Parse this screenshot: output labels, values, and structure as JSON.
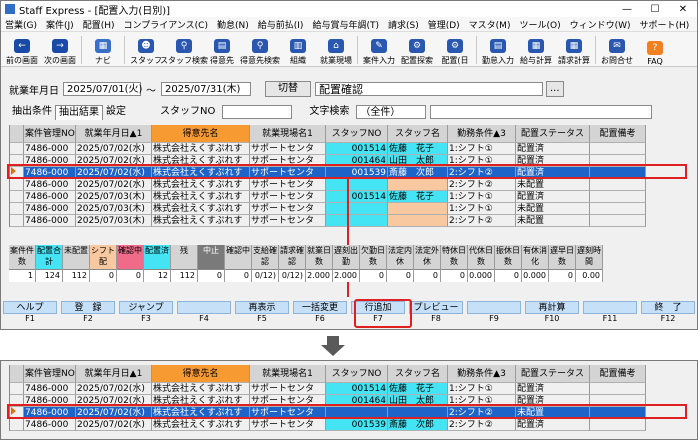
{
  "window": {
    "title": "Staff Express - [配置入力(日別)]",
    "controls": [
      "—",
      "☐",
      "✕"
    ]
  },
  "menu": [
    "営業(G)",
    "案件(J)",
    "配置(H)",
    "コンプライアンス(C)",
    "勤怠(N)",
    "給与前払(I)",
    "給与賞与年調(T)",
    "請求(S)",
    "管理(D)",
    "マスタ(M)",
    "ツール(O)",
    "ウィンドウ(W)",
    "サポート(H)"
  ],
  "toolbar": [
    {
      "label": "前の画面",
      "icon": "←",
      "color": "#1a4aa8"
    },
    {
      "label": "次の画面",
      "icon": "→",
      "color": "#1a4aa8"
    },
    {
      "label": "ナビ",
      "icon": "▦",
      "color": "#3a6fc8"
    },
    {
      "label": "スタッフ",
      "icon": "☻",
      "color": "#2a58b0"
    },
    {
      "label": "スタッフ検索",
      "icon": "⚲",
      "color": "#2a58b0"
    },
    {
      "label": "得意先",
      "icon": "▤",
      "color": "#2a58b0"
    },
    {
      "label": "得意先検索",
      "icon": "⚲",
      "color": "#2a58b0"
    },
    {
      "label": "組織",
      "icon": "▥",
      "color": "#2a58b0"
    },
    {
      "label": "就業現場",
      "icon": "⌂",
      "color": "#2a58b0"
    },
    {
      "label": "案件入力",
      "icon": "✎",
      "color": "#2a58b0"
    },
    {
      "label": "配置探索",
      "icon": "⚙",
      "color": "#2a58b0"
    },
    {
      "label": "配置(日",
      "icon": "⚙",
      "color": "#2a58b0"
    },
    {
      "label": "勤怠入力",
      "icon": "▤",
      "color": "#2a58b0"
    },
    {
      "label": "給与計算",
      "icon": "▦",
      "color": "#2a58b0"
    },
    {
      "label": "請求計算",
      "icon": "▦",
      "color": "#2a58b0"
    },
    {
      "label": "お問合せ",
      "icon": "✉",
      "color": "#2a58b0"
    },
    {
      "label": "FAQ",
      "icon": "?",
      "color": "#f08020"
    }
  ],
  "filters": {
    "date_label": "就業年月日",
    "date_from": "2025/07/01(火)",
    "tilde": "〜",
    "date_to": "2025/07/31(木)",
    "switch_button": "切替",
    "mode": "配置確認",
    "more": "...",
    "staff_no_label": "スタッフNO",
    "text_search_label": "文字検索",
    "text_search_value": "（全件）"
  },
  "tabs": [
    "抽出条件",
    "抽出結果",
    "設定"
  ],
  "columns": [
    "案件管理NO",
    "就業年月日▲1",
    "得意先名",
    "就業現場名1",
    "スタッフNO",
    "スタッフ名",
    "勤務条件▲3",
    "配置ステータス",
    "配置備考"
  ],
  "rows": [
    {
      "no": "7486-000",
      "date": "2025/07/02(水)",
      "client": "株式会社えくすぷれす",
      "site": "サポートセンタ",
      "staff_no": "001514",
      "staff": "佐藤　花子",
      "cond": "1:シフト①",
      "status": "配置済",
      "note": "",
      "selected": false
    },
    {
      "no": "7486-000",
      "date": "2025/07/02(水)",
      "client": "株式会社えくすぷれす",
      "site": "サポートセンタ",
      "staff_no": "001464",
      "staff": "山田　太郎",
      "cond": "1:シフト①",
      "status": "配置済",
      "note": "",
      "selected": false
    },
    {
      "no": "7486-000",
      "date": "2025/07/02(水)",
      "client": "株式会社えくすぷれす",
      "site": "サポートセンタ",
      "staff_no": "001539",
      "staff": "斎藤　次郎",
      "cond": "2:シフト②",
      "status": "配置済",
      "note": "",
      "selected": true
    },
    {
      "no": "7486-000",
      "date": "2025/07/02(水)",
      "client": "株式会社えくすぷれす",
      "site": "サポートセンタ",
      "staff_no": "",
      "staff": "",
      "cond": "2:シフト②",
      "status": "未配置",
      "note": "",
      "selected": false
    },
    {
      "no": "7486-000",
      "date": "2025/07/03(木)",
      "client": "株式会社えくすぷれす",
      "site": "サポートセンタ",
      "staff_no": "001514",
      "staff": "佐藤　花子",
      "cond": "1:シフト①",
      "status": "配置済",
      "note": "",
      "selected": false
    },
    {
      "no": "7486-000",
      "date": "2025/07/03(木)",
      "client": "株式会社えくすぷれす",
      "site": "サポートセンタ",
      "staff_no": "",
      "staff": "",
      "cond": "1:シフト①",
      "status": "未配置",
      "note": "",
      "selected": false
    },
    {
      "no": "7486-000",
      "date": "2025/07/03(木)",
      "client": "株式会社えくすぷれす",
      "site": "サポートセンタ",
      "staff_no": "",
      "staff": "",
      "cond": "2:シフト②",
      "status": "未配置",
      "note": "",
      "selected": false
    }
  ],
  "summary": [
    {
      "h": "案件件数",
      "v": "1"
    },
    {
      "h": "配置合計",
      "v": "124"
    },
    {
      "h": "未配置",
      "v": "112"
    },
    {
      "h": "シフト配",
      "v": "0"
    },
    {
      "h": "確認中",
      "v": "0"
    },
    {
      "h": "配置済",
      "v": "12"
    },
    {
      "h": "残",
      "v": "112"
    },
    {
      "h": "中止",
      "v": "0"
    },
    {
      "h": "確認中",
      "v": "0"
    },
    {
      "h": "支給確認",
      "v": "0/12)"
    },
    {
      "h": "請求確認",
      "v": "0/12)"
    },
    {
      "h": "就業日数",
      "v": "2.000"
    },
    {
      "h": "遅刻出勤",
      "v": "2.000"
    },
    {
      "h": "欠勤日数",
      "v": "0"
    },
    {
      "h": "法定内休",
      "v": "0"
    },
    {
      "h": "法定外休",
      "v": "0"
    },
    {
      "h": "特休日数",
      "v": "0"
    },
    {
      "h": "代休日数",
      "v": "0.000"
    },
    {
      "h": "振休日数",
      "v": "0"
    },
    {
      "h": "有休消化",
      "v": "0.000"
    },
    {
      "h": "遅早日数",
      "v": "0"
    },
    {
      "h": "遅刻時間",
      "v": "0.00"
    }
  ],
  "fkeys": [
    {
      "label": "ヘルプ",
      "key": "F1"
    },
    {
      "label": "登　録",
      "key": "F2"
    },
    {
      "label": "ジャンプ",
      "key": "F3"
    },
    {
      "label": "",
      "key": "F4"
    },
    {
      "label": "再表示",
      "key": "F5"
    },
    {
      "label": "一括変更",
      "key": "F6"
    },
    {
      "label": "行追加",
      "key": "F7"
    },
    {
      "label": "プレビュー",
      "key": "F8"
    },
    {
      "label": "",
      "key": "F9"
    },
    {
      "label": "再計算",
      "key": "F10"
    },
    {
      "label": "",
      "key": "F11"
    },
    {
      "label": "終　了",
      "key": "F12"
    }
  ],
  "after_rows": [
    {
      "no": "7486-000",
      "date": "2025/07/02(水)",
      "client": "株式会社えくすぷれす",
      "site": "サポートセンタ",
      "staff_no": "001514",
      "staff": "佐藤　花子",
      "cond": "1:シフト①",
      "status": "配置済",
      "selected": false
    },
    {
      "no": "7486-000",
      "date": "2025/07/02(水)",
      "client": "株式会社えくすぷれす",
      "site": "サポートセンタ",
      "staff_no": "001464",
      "staff": "山田　太郎",
      "cond": "1:シフト①",
      "status": "配置済",
      "selected": false
    },
    {
      "no": "7486-000",
      "date": "2025/07/02(水)",
      "client": "株式会社えくすぷれす",
      "site": "サポートセンタ",
      "staff_no": "",
      "staff": "",
      "cond": "2:シフト②",
      "status": "未配置",
      "selected": true
    },
    {
      "no": "7486-000",
      "date": "2025/07/02(水)",
      "client": "株式会社えくすぷれす",
      "site": "サポートセンタ",
      "staff_no": "001539",
      "staff": "斎藤　次郎",
      "cond": "2:シフト②",
      "status": "配置済",
      "selected": false
    }
  ]
}
